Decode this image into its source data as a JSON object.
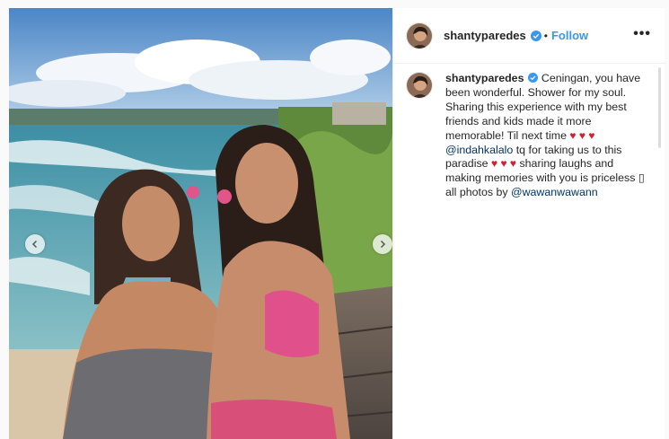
{
  "post": {
    "username": "shantyparedes",
    "separator": "•",
    "follow_label": "Follow",
    "more_label": "•••"
  },
  "caption": {
    "username": "shantyparedes",
    "text_1": " Ceningan, you have been wonderful. Shower for my soul. Sharing this experience with my best friends and kids made it more memorable! Til next time ",
    "hearts_1": "♥ ♥ ♥",
    "mention_1": "@indahkalalo",
    "text_2": " tq for taking us to this paradise ",
    "hearts_2": "♥ ♥ ♥",
    "text_3": " sharing laughs and making memories with you is priceless ▯ all photos by ",
    "mention_2": "@wawanwawann"
  },
  "colors": {
    "link": "#3897f0",
    "mention": "#003569",
    "heart": "#d2202f",
    "verified": "#3897f0"
  },
  "icons": {
    "verified": "verified-badge-icon",
    "prev": "chevron-left-icon",
    "next": "chevron-right-icon",
    "more": "more-options-icon"
  }
}
